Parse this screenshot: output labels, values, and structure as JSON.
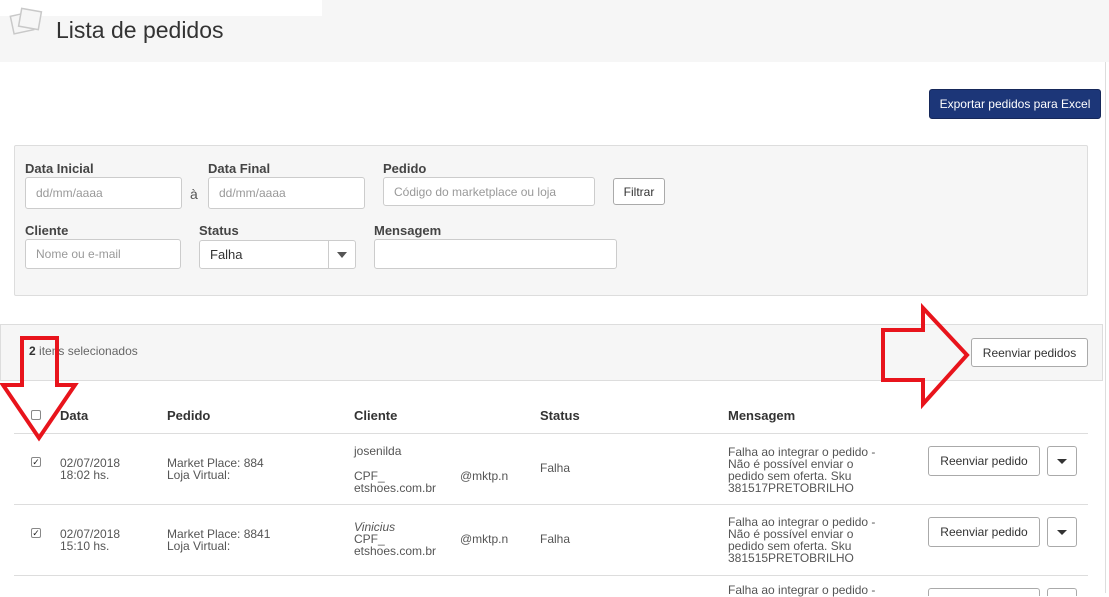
{
  "header": {
    "title": "Lista de pedidos",
    "logo_icon": "orders-logo-icon"
  },
  "toolbar": {
    "export_label": "Exportar pedidos para Excel",
    "export_color": "#1c3678"
  },
  "filters": {
    "start_date": {
      "label": "Data Inicial",
      "placeholder": "dd/mm/aaaa",
      "value": ""
    },
    "range_sep": "à",
    "end_date": {
      "label": "Data Final",
      "placeholder": "dd/mm/aaaa",
      "value": ""
    },
    "order": {
      "label": "Pedido",
      "placeholder": "Código do marketplace ou loja",
      "value": ""
    },
    "filter_label": "Filtrar",
    "client": {
      "label": "Cliente",
      "placeholder": "Nome ou e-mail",
      "value": ""
    },
    "status": {
      "label": "Status",
      "selected": "Falha"
    },
    "message": {
      "label": "Mensagem",
      "value": ""
    }
  },
  "bulk": {
    "count": "2",
    "selected_text": " itens selecionados",
    "resend_label": "Reenviar pedidos"
  },
  "table": {
    "headers": [
      "Data",
      "Pedido",
      "Cliente",
      "Status",
      "Mensagem"
    ],
    "rows": [
      {
        "checked": true,
        "date": "02/07/2018",
        "time": "18:02 hs.",
        "market": "Market Place: 884",
        "store": "Loja Virtual:",
        "client_name": "josenilda",
        "cpf": "CPF_",
        "email_domain": "@mktp.n",
        "email_host": "etshoes.com.br",
        "status": "Falha",
        "message": [
          "Falha ao integrar o pedido -",
          "Não é possível enviar o",
          "pedido sem oferta. Sku",
          "381517PRETOBRILHO"
        ],
        "action_label": "Reenviar pedido"
      },
      {
        "checked": true,
        "date": "02/07/2018",
        "time": "15:10 hs.",
        "market": "Market Place: 8841",
        "store": "Loja Virtual:",
        "client_name": "Vinicius",
        "cpf": "CPF_",
        "email_domain": "@mktp.n",
        "email_host": "etshoes.com.br",
        "status": "Falha",
        "message": [
          "Falha ao integrar o pedido -",
          "Não é possível enviar o",
          "pedido sem oferta. Sku",
          "381515PRETOBRILHO"
        ],
        "action_label": "Reenviar pedido"
      },
      {
        "message": [
          "Falha ao integrar o pedido -"
        ]
      }
    ]
  },
  "annotations": {
    "arrow_color": "#e8141c"
  }
}
